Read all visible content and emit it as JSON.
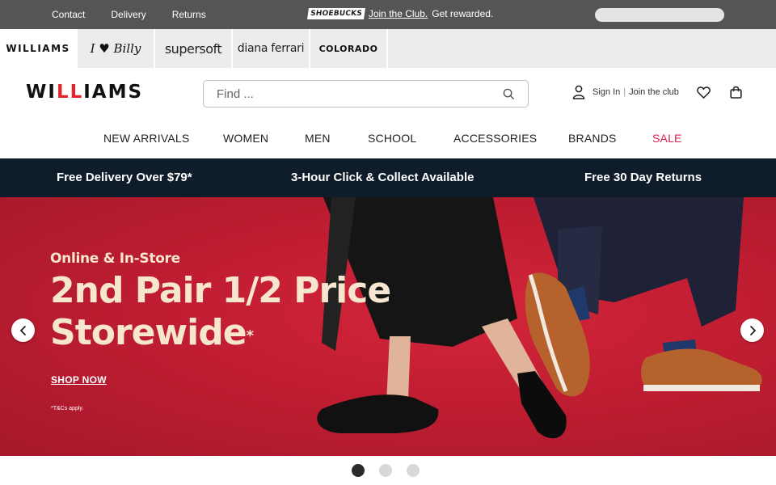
{
  "topbar": {
    "links": [
      "Contact",
      "Delivery",
      "Returns"
    ],
    "promo_logo": "SHOEBUCKS",
    "promo_link": "Join the Club.",
    "promo_text": "Get rewarded."
  },
  "brands": [
    "WILLIAMS",
    "I ♥ Billy",
    "supersoft",
    "diana ferrari",
    "COLORADO"
  ],
  "header": {
    "logo_parts": [
      "WI",
      "LL",
      "IAMS"
    ],
    "search_placeholder": "Find ...",
    "sign_in": "Sign In",
    "join": "Join the club"
  },
  "nav": [
    "NEW ARRIVALS",
    "WOMEN",
    "MEN",
    "SCHOOL",
    "ACCESSORIES",
    "BRANDS",
    "SALE"
  ],
  "usp": [
    "Free Delivery Over $79*",
    "3-Hour Click & Collect Available",
    "Free 30 Day Returns"
  ],
  "hero": {
    "subtitle": "Online & In-Store",
    "headline_line1": "2nd Pair 1/2 Price",
    "headline_line2": "Storewide",
    "headline_mark": "*",
    "cta": "SHOP NOW",
    "terms": "*T&Cs apply."
  },
  "carousel": {
    "slides": 3,
    "active_index": 0
  },
  "colors": {
    "topbar_bg": "#555555",
    "usp_bg": "#0f1c2a",
    "sale": "#d91c4f",
    "hero_bg": "#c01d32",
    "hero_text": "#f6e5cf",
    "logo_accent": "#e3242b"
  }
}
